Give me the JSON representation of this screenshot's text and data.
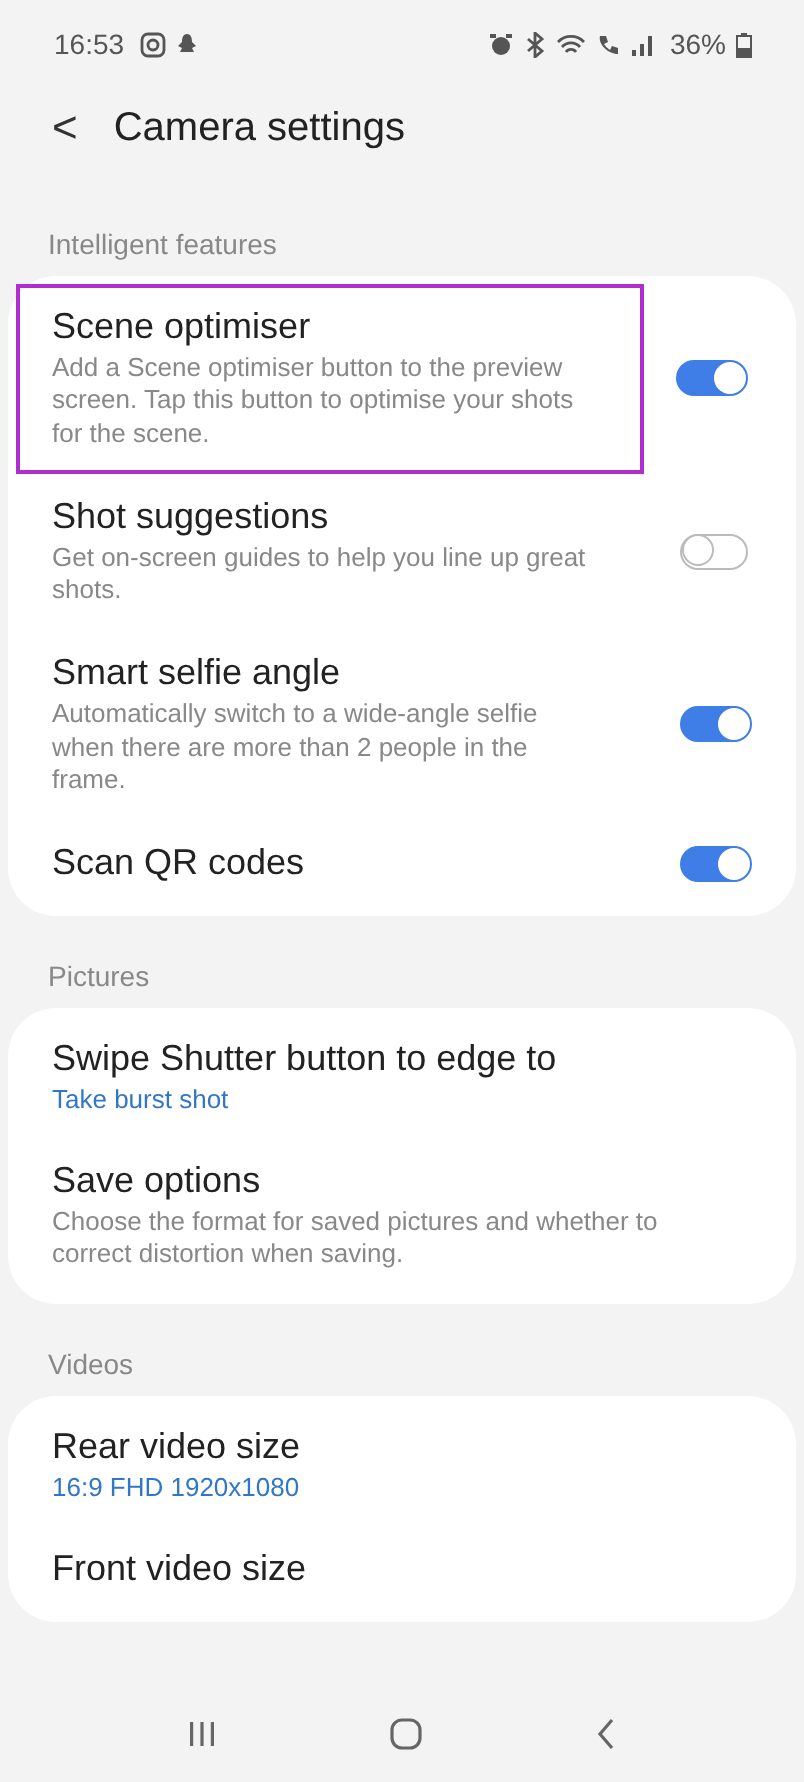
{
  "status_bar": {
    "time": "16:53",
    "battery": "36%"
  },
  "header": {
    "back": "<",
    "title": "Camera settings"
  },
  "sections": [
    {
      "label": "Intelligent features",
      "items": [
        {
          "kind": "toggle",
          "title": "Scene optimiser",
          "description": "Add a Scene optimiser button to the preview screen. Tap this button to optimise your shots for the scene.",
          "on": true,
          "highlighted": true
        },
        {
          "kind": "toggle",
          "title": "Shot suggestions",
          "description": "Get on-screen guides to help you line up great shots.",
          "on": false,
          "highlighted": false
        },
        {
          "kind": "toggle",
          "title": "Smart selfie angle",
          "description": "Automatically switch to a wide-angle selfie when there are more than 2 people in the frame.",
          "on": true,
          "highlighted": false
        },
        {
          "kind": "toggle",
          "title": "Scan QR codes",
          "on": true,
          "highlighted": false
        }
      ]
    },
    {
      "label": "Pictures",
      "items": [
        {
          "kind": "value",
          "title": "Swipe Shutter button to edge to",
          "value": "Take burst shot"
        },
        {
          "kind": "plain",
          "title": "Save options",
          "description": "Choose the format for saved pictures and whether to correct distortion when saving."
        }
      ]
    },
    {
      "label": "Videos",
      "items": [
        {
          "kind": "value",
          "title": "Rear video size",
          "value": "16:9 FHD 1920x1080"
        },
        {
          "kind": "plain",
          "title": "Front video size"
        }
      ]
    }
  ]
}
